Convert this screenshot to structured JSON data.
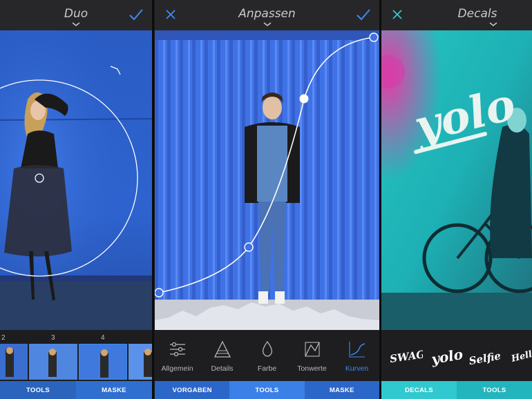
{
  "panels": [
    {
      "title": "Duo",
      "left_icon": "none",
      "right_icon": "checkmark-icon",
      "filmstrip": {
        "numbers": [
          "2",
          "3",
          "4"
        ]
      },
      "tabs": [
        {
          "label": "TOOLS",
          "active": true
        },
        {
          "label": "MASKE",
          "active": false
        }
      ]
    },
    {
      "title": "Anpassen",
      "left_icon": "close-icon",
      "right_icon": "checkmark-icon",
      "tools": [
        {
          "label": "Allgemein",
          "icon": "sliders-icon",
          "active": false
        },
        {
          "label": "Details",
          "icon": "triangle-icon",
          "active": false
        },
        {
          "label": "Farbe",
          "icon": "drop-icon",
          "active": false
        },
        {
          "label": "Tonwerte",
          "icon": "tone-icon",
          "active": false
        },
        {
          "label": "Kurven",
          "icon": "curve-icon",
          "active": true
        }
      ],
      "tabs": [
        {
          "label": "VORGABEN",
          "active": false
        },
        {
          "label": "TOOLS",
          "active": true
        },
        {
          "label": "MASKE",
          "active": false
        }
      ]
    },
    {
      "title": "Decals",
      "left_icon": "close-icon",
      "right_icon": "none",
      "photo_text": "yolo",
      "decals": [
        "SWAG",
        "yolo",
        "Selfie",
        "Hell yeah"
      ],
      "tabs": [
        {
          "label": "DECALS",
          "active": true
        },
        {
          "label": "TOOLS",
          "active": false
        }
      ]
    }
  ],
  "colors": {
    "accent_blue": "#3d8bf0",
    "teal": "#2fc9cf",
    "panel_bg": "#222224"
  }
}
